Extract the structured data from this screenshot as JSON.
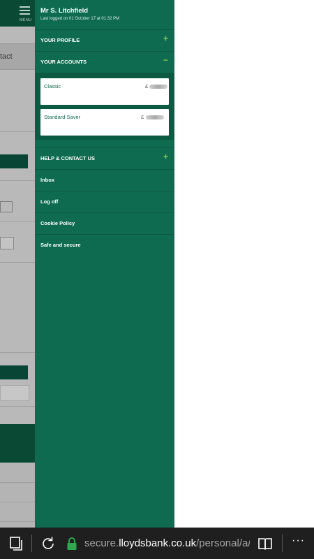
{
  "background": {
    "contact_fragment": "tact",
    "menu_button_label": "MENU"
  },
  "menu": {
    "user_name": "Mr S. Litchfield",
    "last_logged": "Last logged on 01 October 17 at 01:32 PM",
    "sections": {
      "profile": {
        "label": "YOUR PROFILE",
        "toggle": "+"
      },
      "accounts": {
        "label": "YOUR ACCOUNTS",
        "toggle": "−"
      },
      "help": {
        "label": "HELP & CONTACT US",
        "toggle": "+"
      }
    },
    "accounts": [
      {
        "name": "Classic",
        "currency": "£"
      },
      {
        "name": "Standard Saver",
        "currency": "£"
      }
    ],
    "items": [
      {
        "label": "Inbox"
      },
      {
        "label": "Log off"
      },
      {
        "label": "Cookie Policy"
      },
      {
        "label": "Safe and secure"
      }
    ]
  },
  "browser": {
    "url_prefix": "secure.",
    "url_domain": "lloydsbank.co.uk",
    "url_path": "/personal/a/mo",
    "more_label": "···",
    "icons": [
      "tabs-icon",
      "refresh-icon",
      "lock-icon",
      "reading-view-icon",
      "more-icon"
    ]
  },
  "colors": {
    "brand_green": "#0e6b4f",
    "dark_green": "#0b5a42",
    "accent_green": "#8cc63f",
    "browser_bar": "#1f1f1f"
  }
}
